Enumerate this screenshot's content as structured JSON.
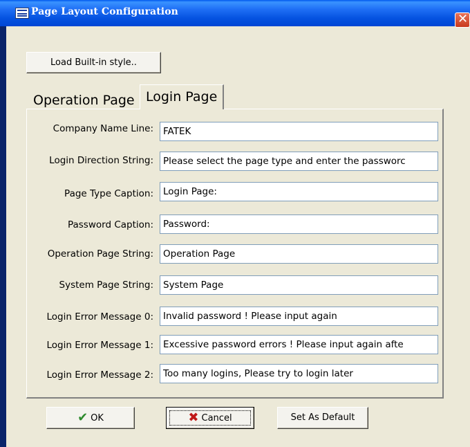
{
  "window": {
    "title": "Page Layout Configuration",
    "close_glyph": "✕"
  },
  "toolbar": {
    "load_button": "Load Built-in style.."
  },
  "tabs": [
    {
      "label": "Operation Page",
      "selected": false
    },
    {
      "label": "Login Page",
      "selected": true
    }
  ],
  "fields": [
    {
      "label": "Company Name Line:",
      "value": "FATEK"
    },
    {
      "label": "Login Direction String:",
      "value": "Please select the page type and enter the passworc"
    },
    {
      "label": "Page Type Caption:",
      "value": "Login Page:"
    },
    {
      "label": "Password Caption:",
      "value": "Password:"
    },
    {
      "label": "Operation Page String:",
      "value": "Operation Page"
    },
    {
      "label": "System Page String:",
      "value": "System Page"
    },
    {
      "label": "Login Error Message 0:",
      "value": "Invalid password ! Please input again"
    },
    {
      "label": "Login Error Message 1:",
      "value": "Excessive password errors ! Please input again afte"
    },
    {
      "label": "Login Error Message 2:",
      "value": "Too many logins, Please try to login later"
    }
  ],
  "buttons": {
    "ok": "OK",
    "cancel": "Cancel",
    "set_default": "Set As Default"
  },
  "icons": {
    "ok": "checkmark-icon",
    "cancel": "x-icon",
    "window": "window-icon"
  }
}
